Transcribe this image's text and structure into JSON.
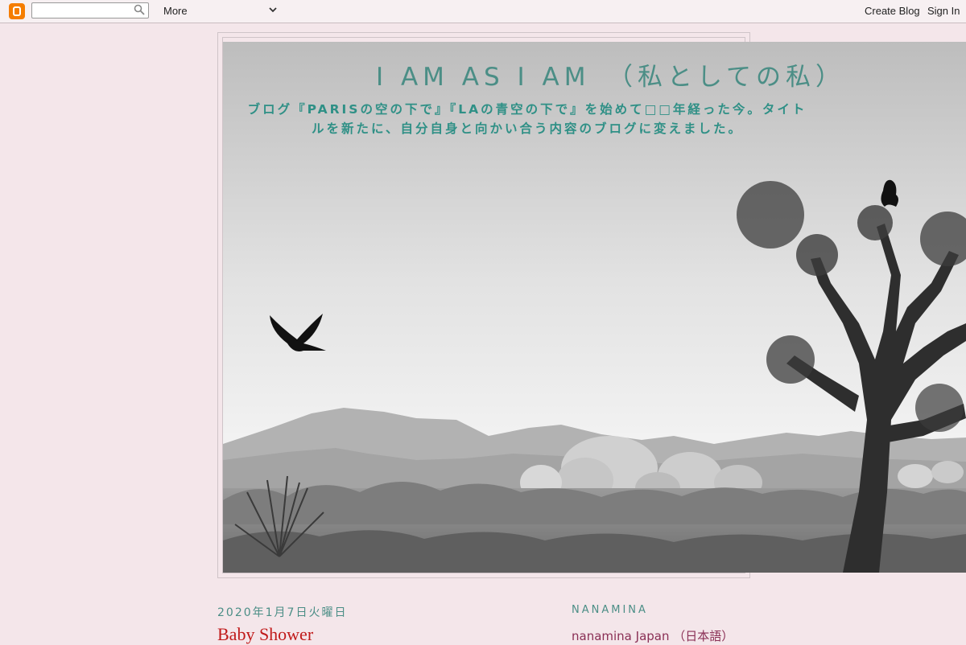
{
  "navbar": {
    "search_value": "",
    "more_label": "More",
    "create_blog_label": "Create Blog",
    "sign_in_label": "Sign In"
  },
  "header": {
    "title": "I AM AS I AM　（私としての私）",
    "description": "ブログ『PARISの空の下で』『LAの青空の下で』を始めて□□年経った今。タイトルを新たに、自分自身と向かい合う内容のブログに変えました。"
  },
  "post": {
    "date": "2020年1月7日火曜日",
    "title": "Baby Shower"
  },
  "sidebar": {
    "heading": "NANAMINA",
    "link": "nanamina Japan （日本語）"
  },
  "colors": {
    "accent": "#4b8e86",
    "post_title": "#c01a1a",
    "link": "#8a2f55",
    "background": "#f4e6ea"
  }
}
